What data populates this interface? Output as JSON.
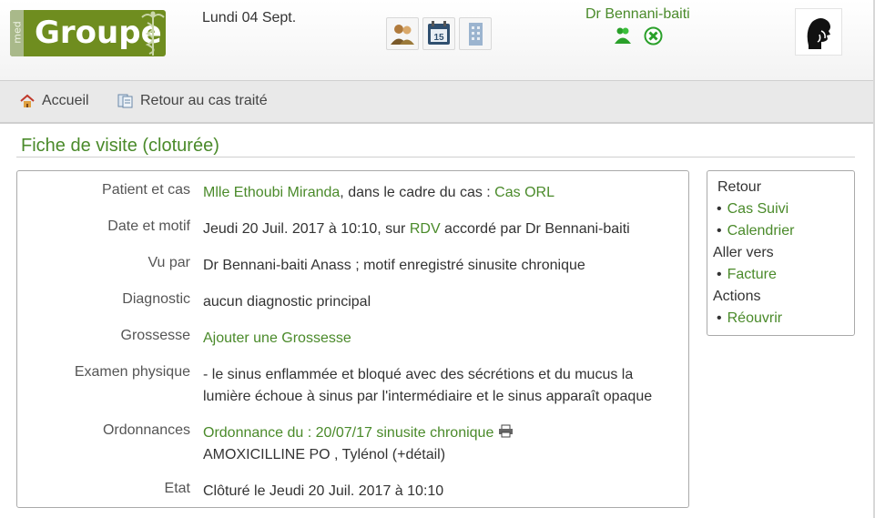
{
  "header": {
    "logo_prefix": "med",
    "logo_text": "Groupe",
    "date": "Lundi 04 Sept.",
    "doctor_name": "Dr Bennani-baiti",
    "icons": [
      "patients-icon",
      "calendar-icon",
      "building-icon",
      "user-status-icon",
      "close-circle-icon",
      "avatar-icon"
    ],
    "calendar_day": "15"
  },
  "nav": {
    "home": "Accueil",
    "back": "Retour au cas traité"
  },
  "page": {
    "title": "Fiche de visite (cloturée)"
  },
  "visit": {
    "patient_label": "Patient et cas",
    "patient_name": "Mlle Ethoubi Miranda",
    "patient_mid": ", dans le cadre du cas : ",
    "patient_case": "Cas ORL",
    "date_label": "Date et motif",
    "date_text": "Jeudi 20 Juil. 2017 à 10:10, sur ",
    "date_link": "RDV",
    "date_end": " accordé par Dr Bennani-baiti",
    "seen_label": "Vu par",
    "seen_text": "Dr Bennani-baiti Anass ; motif enregistré sinusite chronique",
    "diag_label": "Diagnostic",
    "diag_text": "aucun diagnostic principal",
    "preg_label": "Grossesse",
    "preg_link": "Ajouter une Grossesse",
    "exam_label": "Examen physique",
    "exam_line1": "- le sinus enflammée et bloqué avec des sécrétions et du mucus la",
    "exam_line2": "lumière échoue à sinus par l'intermédiaire et le sinus apparaît opaque",
    "ord_label": "Ordonnances",
    "ord_link": "Ordonnance du : 20/07/17 sinusite chronique",
    "ord_meds": "AMOXICILLINE PO , Tylénol (+détail)",
    "state_label": "Etat",
    "state_text": "Clôturé le Jeudi 20 Juil. 2017 à 10:10"
  },
  "sidebar": {
    "h1": "Retour",
    "l1": "Cas Suivi",
    "l2": "Calendrier",
    "h2": "Aller vers",
    "l3": "Facture",
    "h3": "Actions",
    "l4": "Réouvrir"
  },
  "colors": {
    "accent_green": "#4a8a2a",
    "logo_green": "#6f8d1f"
  }
}
